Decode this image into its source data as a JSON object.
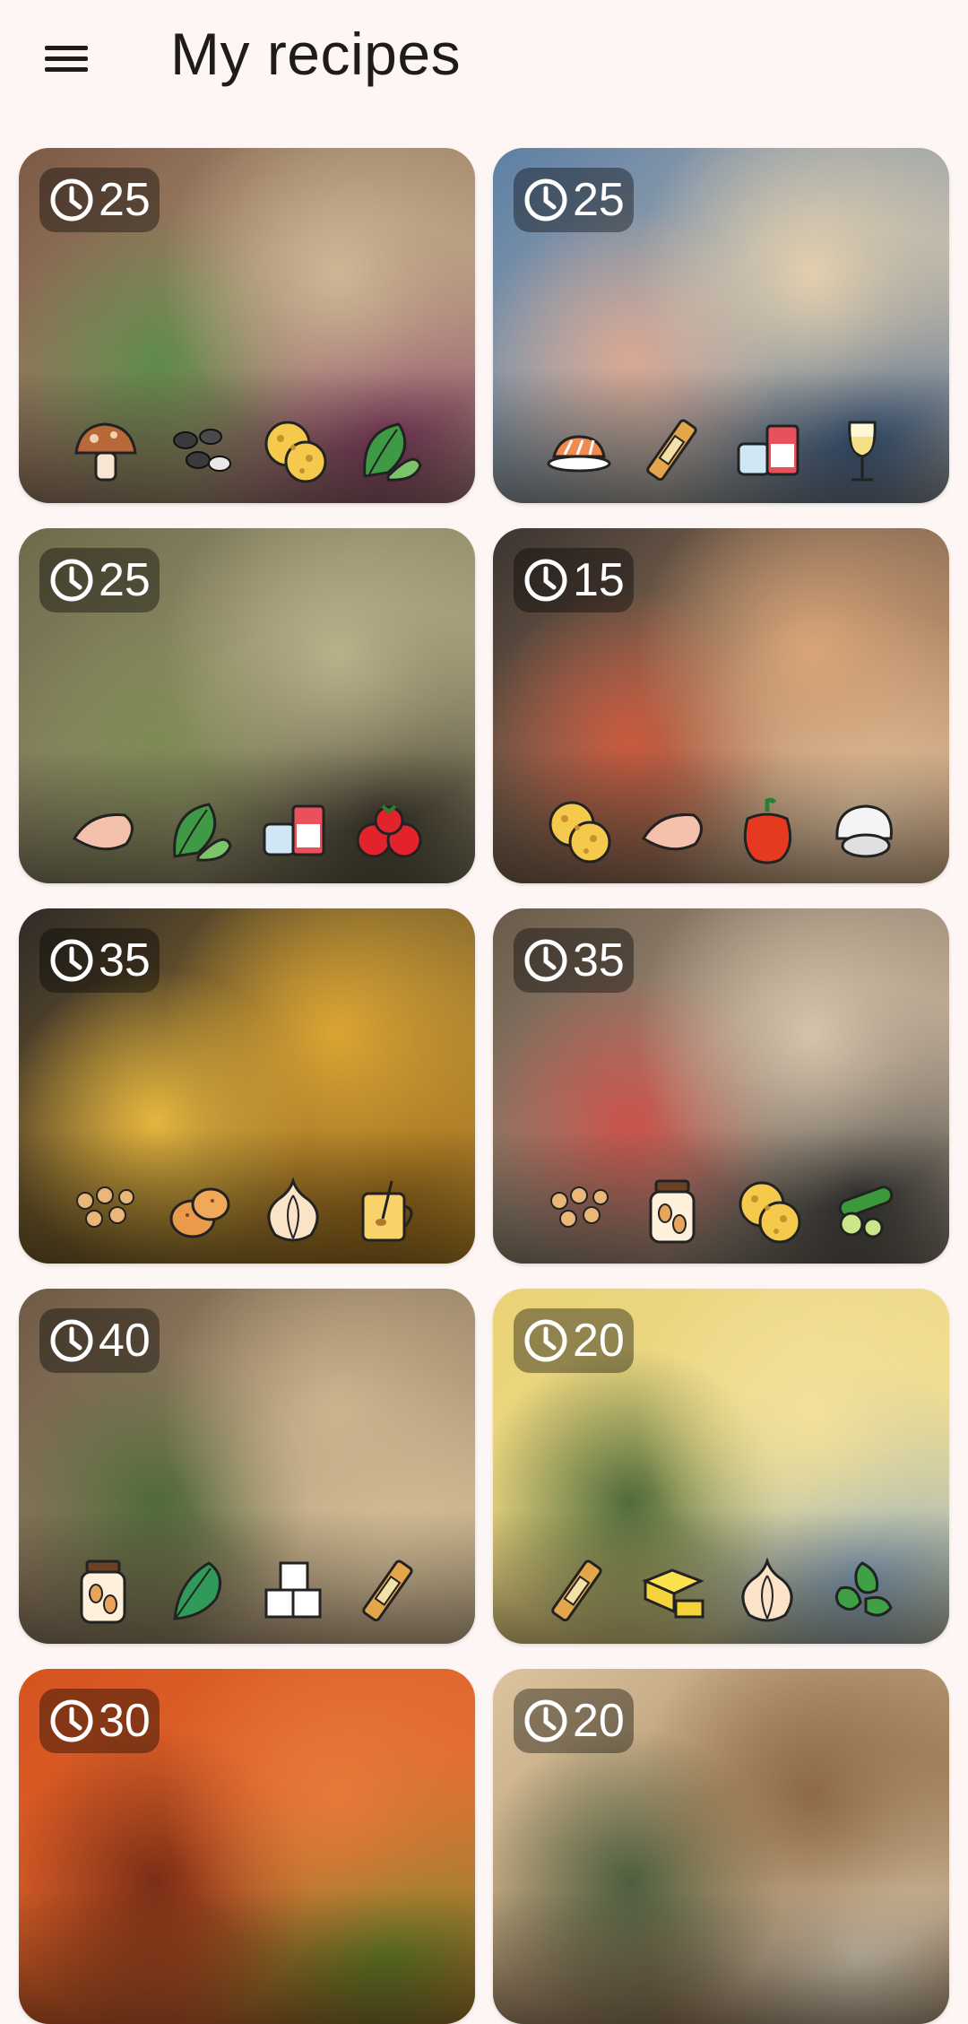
{
  "app": {
    "title": "My recipes",
    "menu_icon": "menu-icon"
  },
  "recipes": [
    {
      "time": "25",
      "photo": "wraps with greens and red cabbage",
      "colors": [
        "#7c5a45",
        "#cdb795",
        "#5f8a4a",
        "#8a3f66"
      ],
      "ingredients": [
        "mushroom-icon",
        "beans-icon",
        "cheese-icon",
        "spinach-icon"
      ]
    },
    {
      "time": "25",
      "photo": "salmon spaghetti",
      "colors": [
        "#5d7fa6",
        "#e3cfae",
        "#d8a894",
        "#3d5d86"
      ],
      "ingredients": [
        "salmon-icon",
        "spaghetti-icon",
        "cream-icon",
        "wine-icon"
      ]
    },
    {
      "time": "25",
      "photo": "creamy pesto close-up",
      "colors": [
        "#6e6a4b",
        "#b8b18a",
        "#7e8a54",
        "#403a2d"
      ],
      "ingredients": [
        "chicken-breast-icon",
        "spinach-icon",
        "cream-icon",
        "tomatoes-icon"
      ]
    },
    {
      "time": "15",
      "photo": "chicken tortilla pizza",
      "colors": [
        "#3b3430",
        "#d9a579",
        "#c85a3f",
        "#e6c9a6"
      ],
      "ingredients": [
        "cheese-icon",
        "chicken-breast-icon",
        "bell-pepper-icon",
        "mushroom-white-icon"
      ]
    },
    {
      "time": "35",
      "photo": "lentil soup",
      "colors": [
        "#2e2a28",
        "#dba533",
        "#e4b53e",
        "#9a6a1d"
      ],
      "ingredients": [
        "chickpeas-icon",
        "potato-icon",
        "garlic-icon",
        "broth-icon"
      ]
    },
    {
      "time": "35",
      "photo": "vegetable wraps",
      "colors": [
        "#6a5a4a",
        "#d6c3ab",
        "#c9524a",
        "#3a3a38"
      ],
      "ingredients": [
        "chickpeas-icon",
        "jar-icon",
        "cheese-icon",
        "cucumber-icon"
      ]
    },
    {
      "time": "40",
      "photo": "tofu noodles",
      "colors": [
        "#6e5a45",
        "#cbb48e",
        "#4f6a3a",
        "#e0c89f"
      ],
      "ingredients": [
        "jar-icon",
        "kale-icon",
        "tofu-icon",
        "spaghetti-icon"
      ]
    },
    {
      "time": "20",
      "photo": "pasta with spinach",
      "colors": [
        "#e9d277",
        "#f2e19a",
        "#4f6b3a",
        "#89a8c7"
      ],
      "ingredients": [
        "spaghetti-icon",
        "butter-icon",
        "garlic-icon",
        "basil-icon"
      ]
    },
    {
      "time": "30",
      "photo": "tomato soup",
      "colors": [
        "#d5531f",
        "#e7783a",
        "#7a2e16",
        "#6a8a2a"
      ],
      "ingredients": []
    },
    {
      "time": "20",
      "photo": "quesadillas",
      "colors": [
        "#dcc49e",
        "#8d6a45",
        "#4d5f3f",
        "#efe1c8"
      ],
      "ingredients": []
    }
  ]
}
